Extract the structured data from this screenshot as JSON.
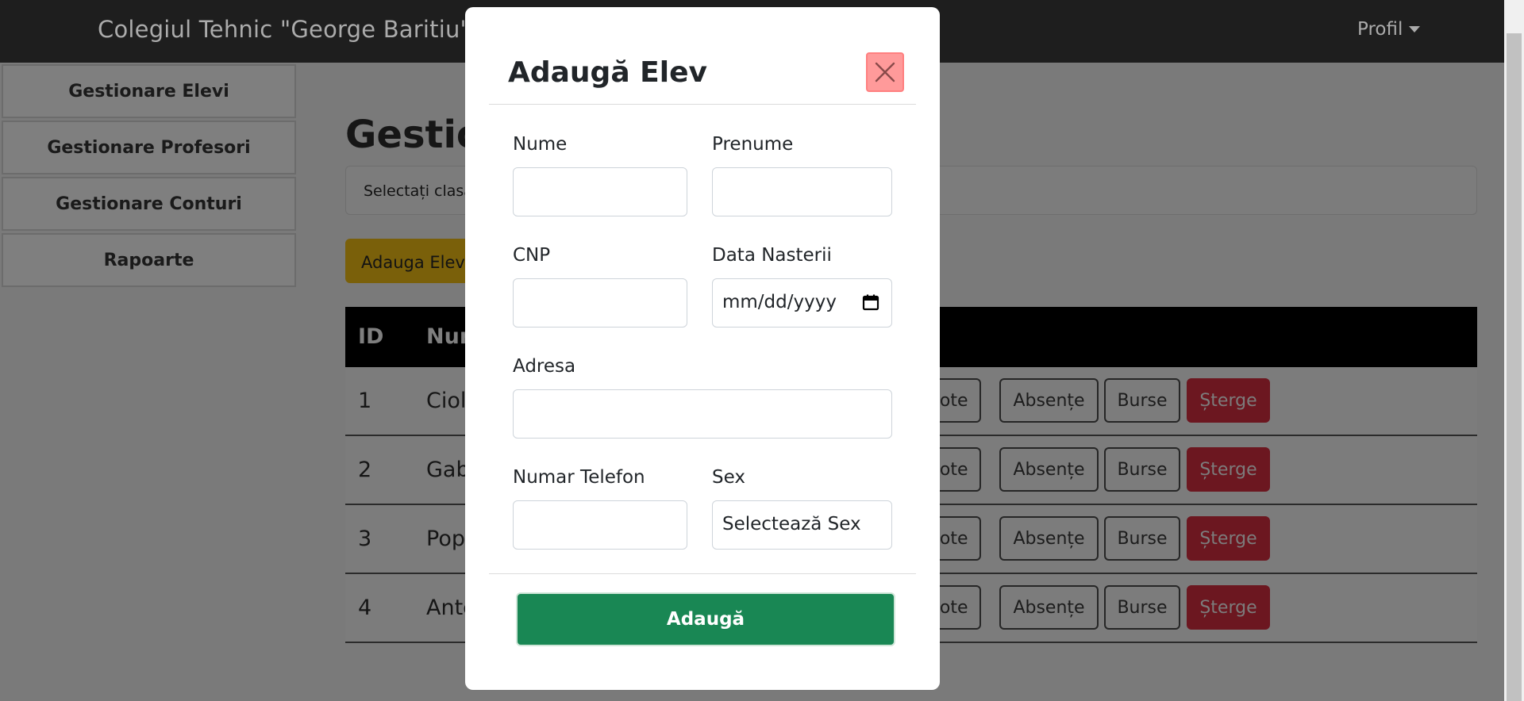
{
  "navbar": {
    "brand": "Colegiul Tehnic \"George Baritiu\"",
    "profile_label": "Profil"
  },
  "sidebar": {
    "items": [
      {
        "label": "Gestionare Elevi"
      },
      {
        "label": "Gestionare Profesori"
      },
      {
        "label": "Gestionare Conturi"
      },
      {
        "label": "Rapoarte"
      }
    ]
  },
  "main": {
    "title": "Gestior",
    "class_select_placeholder": "Selectați clasa",
    "add_button": "Adauga Elev",
    "table": {
      "columns": [
        "ID",
        "Nur"
      ],
      "rows": [
        {
          "id": "1",
          "name": "Ciol"
        },
        {
          "id": "2",
          "name": "Gab"
        },
        {
          "id": "3",
          "name": "Pop"
        },
        {
          "id": "4",
          "name": "Ante"
        }
      ],
      "actions": {
        "note": "Note",
        "absente": "Absențe",
        "burse": "Burse",
        "sterge": "Șterge"
      }
    }
  },
  "modal": {
    "title": "Adaugă Elev",
    "fields": {
      "nume": {
        "label": "Nume",
        "value": ""
      },
      "prenume": {
        "label": "Prenume",
        "value": ""
      },
      "cnp": {
        "label": "CNP",
        "value": ""
      },
      "data_nasterii": {
        "label": "Data Nasterii",
        "value": "mm/dd/yyyy"
      },
      "adresa": {
        "label": "Adresa",
        "value": ""
      },
      "numar_telefon": {
        "label": "Numar Telefon",
        "value": ""
      },
      "sex": {
        "label": "Sex",
        "value": "Selectează Sex"
      }
    },
    "submit_label": "Adaugă"
  },
  "colors": {
    "navbar": "#1e1e1e",
    "submit": "#198754",
    "close": "#ff9a9a",
    "danger": "#dc3545",
    "warning": "#ffc107"
  },
  "icons": {
    "close": "close-icon",
    "calendar": "calendar-icon",
    "profile_caret": "caret-down-icon"
  }
}
